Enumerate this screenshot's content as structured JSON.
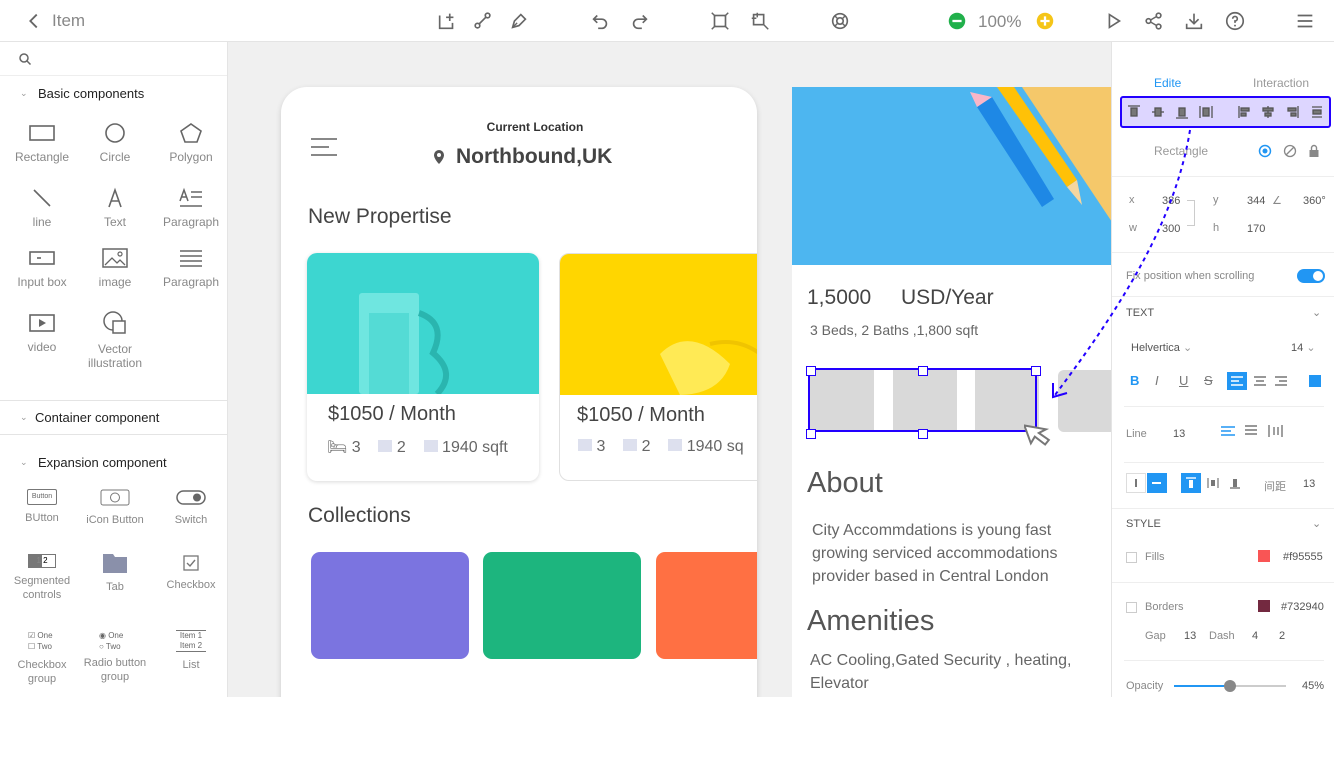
{
  "topbar": {
    "back_label": "Item",
    "zoom": "100%"
  },
  "search": {
    "placeholder": ""
  },
  "sections": {
    "basic": "Basic components",
    "container": "Container component",
    "expansion": "Expansion component"
  },
  "basic_components": [
    {
      "label": "Rectangle",
      "icon": "rectangle-icon"
    },
    {
      "label": "Circle",
      "icon": "circle-icon"
    },
    {
      "label": "Polygon",
      "icon": "polygon-icon"
    },
    {
      "label": "line",
      "icon": "line-icon"
    },
    {
      "label": "Text",
      "icon": "text-icon"
    },
    {
      "label": "Paragraph",
      "icon": "paragraph-icon"
    },
    {
      "label": "Input box",
      "icon": "input-box-icon"
    },
    {
      "label": "image",
      "icon": "image-icon"
    },
    {
      "label": "Paragraph",
      "icon": "paragraph-list-icon"
    },
    {
      "label": "video",
      "icon": "video-icon"
    },
    {
      "label": "Vector illustration",
      "icon": "vector-icon"
    }
  ],
  "expansion_components": [
    {
      "label": "BUtton",
      "icon": "button-icon",
      "inner": "Button"
    },
    {
      "label": "iCon Button",
      "icon": "icon-button-icon"
    },
    {
      "label": "Switch",
      "icon": "switch-icon"
    },
    {
      "label": "Segmented controls",
      "icon": "segmented-icon",
      "inner": "1 2"
    },
    {
      "label": "Tab",
      "icon": "tab-icon"
    },
    {
      "label": "Checkbox",
      "icon": "checkbox-icon"
    },
    {
      "label": "Checkbox group",
      "icon": "checkbox-group-icon",
      "opt1": "One",
      "opt2": "Two"
    },
    {
      "label": "Radio button group",
      "icon": "radio-group-icon",
      "opt1": "One",
      "opt2": "Two"
    },
    {
      "label": "List",
      "icon": "list-icon",
      "opt1": "Item 1",
      "opt2": "Item 2"
    }
  ],
  "phone1": {
    "location_caption": "Current Location",
    "location": "Northbound,UK",
    "section1": "New Propertise",
    "cards": [
      {
        "price": "$1050 / Month",
        "beds": "3",
        "baths": "2",
        "area": "1940 sqft",
        "color": "#3dd6d0"
      },
      {
        "price": "$1050 / Month",
        "beds": "3",
        "baths": "2",
        "area": "1940 sq",
        "color": "#ffd600"
      }
    ],
    "section2": "Collections",
    "collections": [
      "#7b74e0",
      "#1db57e",
      "#ff7043"
    ]
  },
  "phone2": {
    "price": "1,5000",
    "unit": "USD/Year",
    "details": "3 Beds, 2 Baths ,1,800 sqft",
    "about_title": "About",
    "about_lines": [
      "City Accommdations  is young fast",
      "growing serviced accommodations",
      "provider based in Central London"
    ],
    "amenities_title": "Amenities",
    "amenities_lines": [
      "AC Cooling,Gated Security , heating,",
      "Elevator"
    ]
  },
  "panel": {
    "tab_edit": "Edite",
    "tab_interaction": "Interaction",
    "element_name": "Rectangle",
    "x_label": "x",
    "x": "386",
    "y_label": "y",
    "y": "344",
    "rotation": "360°",
    "w_label": "w",
    "w": "300",
    "h_label": "h",
    "h": "170",
    "fix_label": "Fix position when scrolling",
    "text_title": "TEXT",
    "font": "Helvertica",
    "size": "14",
    "format": [
      "B",
      "I",
      "U",
      "S"
    ],
    "line_label": "Line",
    "line_value": "13",
    "spacing_label": "间距",
    "spacing_value": "13",
    "style_title": "STYLE",
    "fills_label": "Fills",
    "fills_color": "#f95555",
    "fills_hex": "#f95555",
    "borders_label": "Borders",
    "borders_color": "#732940",
    "borders_hex": "#732940",
    "gap_label": "Gap",
    "gap": "13",
    "dash_label": "Dash",
    "dash1": "4",
    "dash2": "2",
    "opacity_label": "Opacity",
    "opacity": "45%",
    "opacity_value": 0.45
  },
  "colors": {
    "accent": "#2196f3",
    "selection": "#2200ff",
    "zoom_minus": "#21b04b",
    "zoom_plus": "#f5c518"
  }
}
